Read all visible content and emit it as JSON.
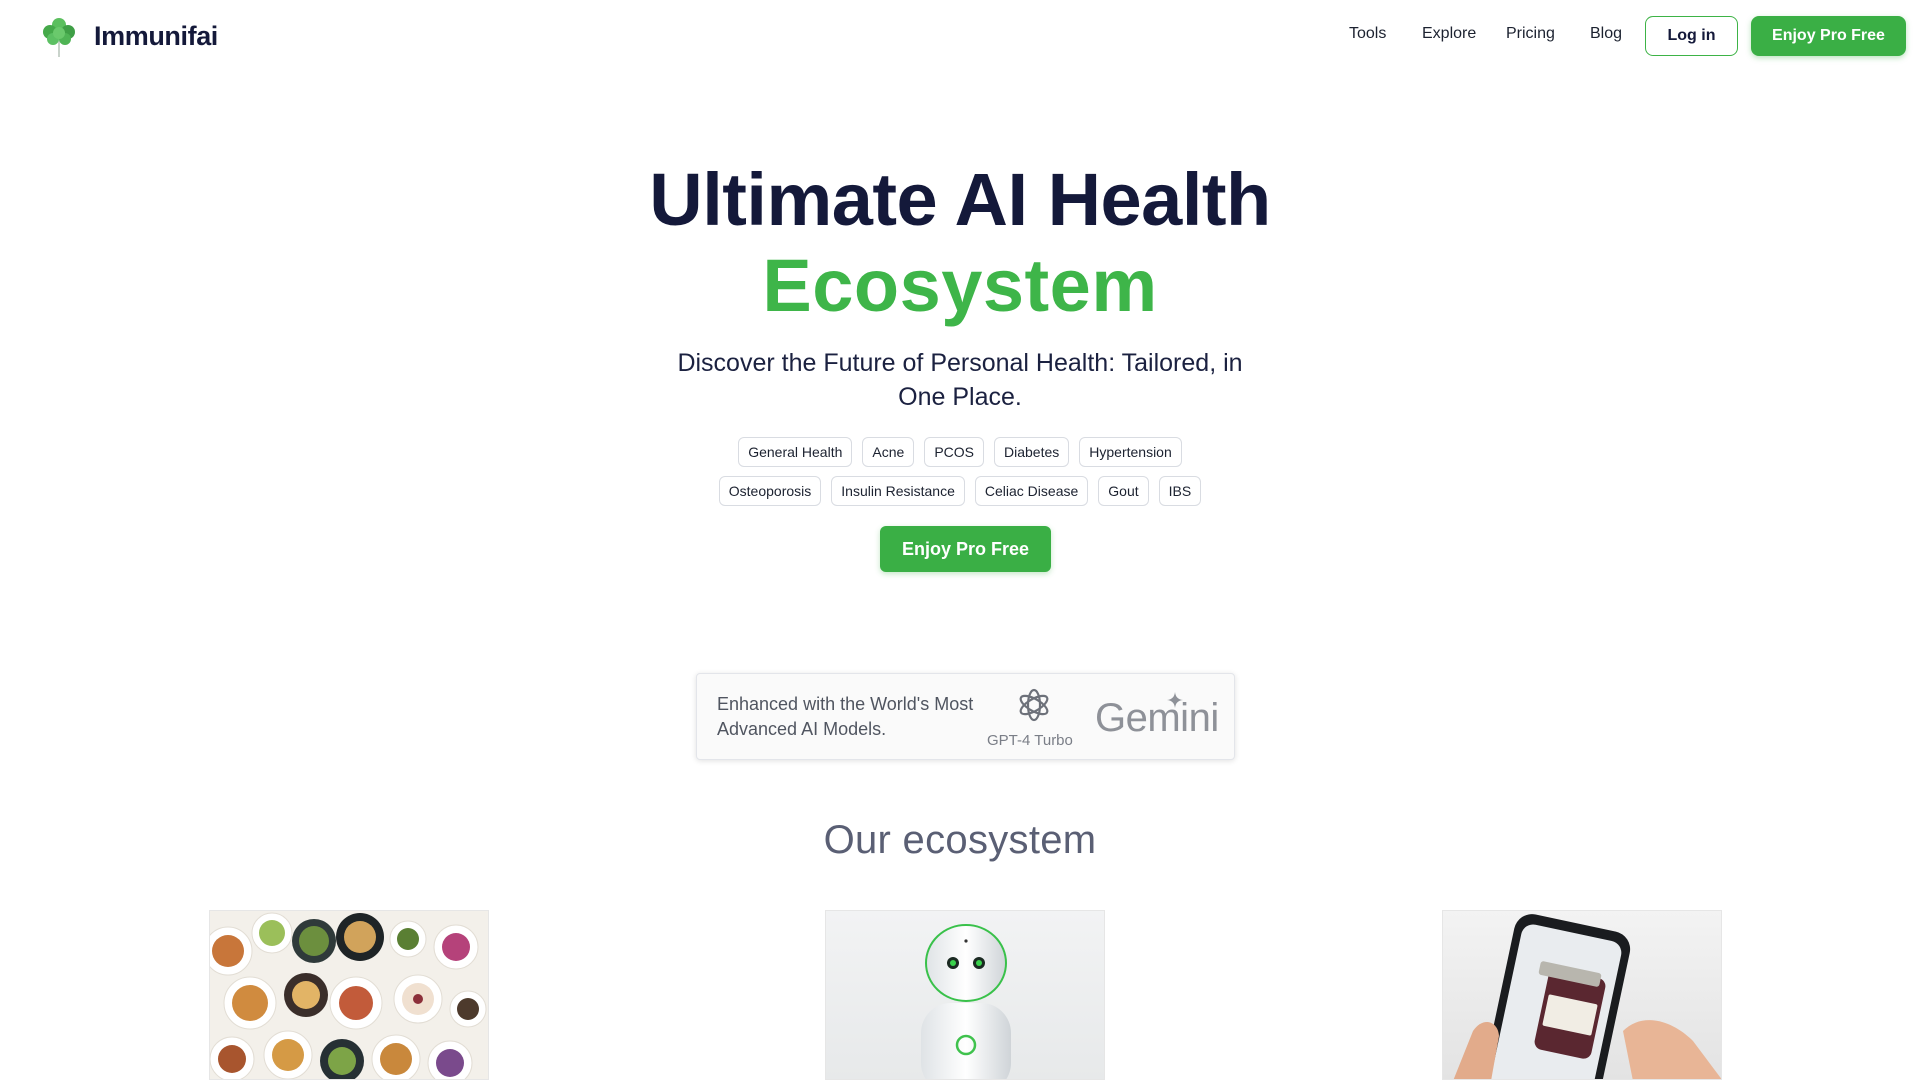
{
  "header": {
    "brand_name": "Immunifai",
    "logo_icon": "clover-leaf-icon",
    "nav": [
      {
        "label": "Tools"
      },
      {
        "label": "Explore"
      },
      {
        "label": "Pricing"
      },
      {
        "label": "Blog"
      }
    ],
    "login_label": "Log in",
    "cta_label": "Enjoy Pro Free"
  },
  "hero": {
    "title_line1": "Ultimate AI Health",
    "title_line2": "Ecosystem",
    "subtitle": "Discover the Future of Personal Health: Tailored, in One Place.",
    "tags_row1": [
      "General Health",
      "Acne",
      "PCOS",
      "Diabetes",
      "Hypertension"
    ],
    "tags_row2": [
      "Osteoporosis",
      "Insulin Resistance",
      "Celiac Disease",
      "Gout",
      "IBS"
    ],
    "cta_label": "Enjoy Pro Free"
  },
  "ai_models": {
    "text": "Enhanced with the World's Most Advanced AI Models.",
    "gpt_icon": "openai-logo-icon",
    "gpt_label": "GPT-4 Turbo",
    "gemini_label": "Gemini"
  },
  "ecosystem": {
    "title": "Our ecosystem",
    "cards": [
      {
        "image": "food-plates-image"
      },
      {
        "image": "robot-assistant-image"
      },
      {
        "image": "phone-scanning-jar-image"
      }
    ]
  },
  "colors": {
    "brand_green": "#3aaf45",
    "title_navy": "#14193a",
    "accent_green_text": "#3eb549"
  }
}
